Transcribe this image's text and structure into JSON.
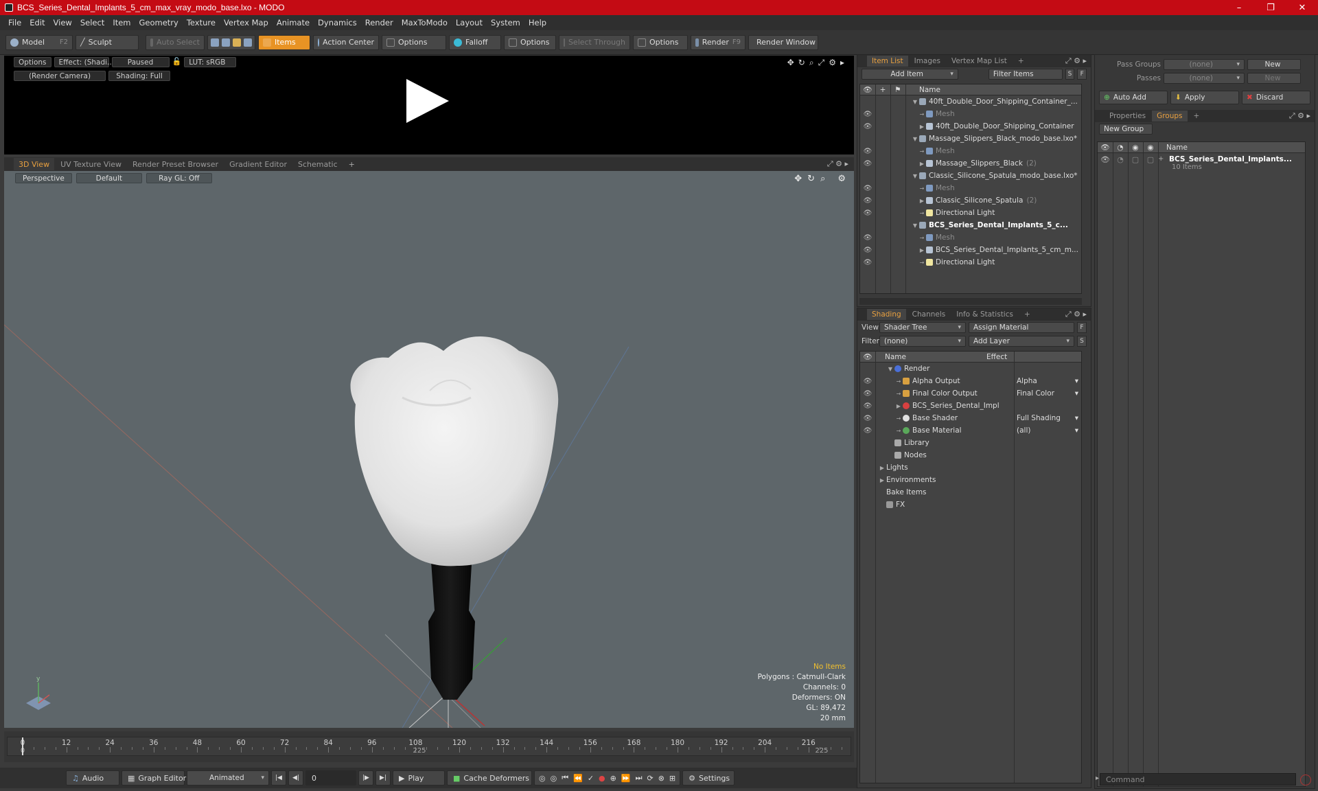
{
  "window": {
    "title": "BCS_Series_Dental_Implants_5_cm_max_vray_modo_base.lxo - MODO",
    "controls": [
      "–",
      "❐",
      "✕"
    ]
  },
  "menu": [
    "File",
    "Edit",
    "View",
    "Select",
    "Item",
    "Geometry",
    "Texture",
    "Vertex Map",
    "Animate",
    "Dynamics",
    "Render",
    "MaxToModo",
    "Layout",
    "System",
    "Help"
  ],
  "toolbar": {
    "model": "Model",
    "model_key": "F2",
    "sculpt": "Sculpt",
    "auto_select": "Auto Select",
    "items": "Items",
    "action_center": "Action Center",
    "options1": "Options",
    "falloff": "Falloff",
    "options2": "Options",
    "select_through": "Select Through",
    "options3": "Options",
    "render": "Render",
    "render_key": "F9",
    "render_window": "Render Window"
  },
  "preview": {
    "options": "Options",
    "effect": "Effect: (Shadi...",
    "paused": "Paused",
    "lut": "LUT: sRGB",
    "camera": "(Render Camera)",
    "shading": "Shading: Full"
  },
  "viewport_tabs": [
    "3D View",
    "UV Texture View",
    "Render Preset Browser",
    "Gradient Editor",
    "Schematic",
    "+"
  ],
  "viewport": {
    "projection": "Perspective",
    "style": "Default",
    "raygl": "Ray GL: Off",
    "info": {
      "no_items": "No Items",
      "polygons": "Polygons : Catmull-Clark",
      "channels": "Channels: 0",
      "deformers": "Deformers: ON",
      "gl": "GL: 89,472",
      "scale": "20 mm"
    }
  },
  "timeline": {
    "labels": [
      "0",
      "12",
      "24",
      "36",
      "48",
      "60",
      "72",
      "84",
      "96",
      "108",
      "120",
      "132",
      "144",
      "156",
      "168",
      "180",
      "192",
      "204",
      "216"
    ],
    "bottom_labels": [
      "0",
      "225",
      "225"
    ]
  },
  "bottombar": {
    "audio": "Audio",
    "graph_editor": "Graph Editor",
    "animated": "Animated",
    "frame": "0",
    "play": "Play",
    "cache_deformers": "Cache Deformers",
    "settings": "Settings"
  },
  "item_list": {
    "tabs": [
      "Item List",
      "Images",
      "Vertex Map List",
      "+"
    ],
    "add_item": "Add Item",
    "filter_items": "Filter Items",
    "s": "S",
    "f": "F",
    "col_name": "Name",
    "rows": [
      {
        "label": "40ft_Double_Door_Shipping_Container_...",
        "indent": 1,
        "arrow": "▼",
        "type": "scene"
      },
      {
        "label": "Mesh",
        "indent": 2,
        "arrow": "",
        "type": "mesh",
        "dim": true
      },
      {
        "label": "40ft_Double_Door_Shipping_Container",
        "indent": 2,
        "arrow": "▶",
        "type": "group"
      },
      {
        "label": "Massage_Slippers_Black_modo_base.lxo*",
        "indent": 1,
        "arrow": "▼",
        "type": "scene"
      },
      {
        "label": "Mesh",
        "indent": 2,
        "arrow": "",
        "type": "mesh",
        "dim": true
      },
      {
        "label": "Massage_Slippers_Black",
        "suffix": "(2)",
        "indent": 2,
        "arrow": "▶",
        "type": "group"
      },
      {
        "label": "Classic_Silicone_Spatula_modo_base.lxo*",
        "indent": 1,
        "arrow": "▼",
        "type": "scene"
      },
      {
        "label": "Mesh",
        "indent": 2,
        "arrow": "",
        "type": "mesh",
        "dim": true
      },
      {
        "label": "Classic_Silicone_Spatula",
        "suffix": "(2)",
        "indent": 2,
        "arrow": "▶",
        "type": "group"
      },
      {
        "label": "Directional Light",
        "indent": 2,
        "arrow": "",
        "type": "light"
      },
      {
        "label": "BCS_Series_Dental_Implants_5_c...",
        "indent": 1,
        "arrow": "▼",
        "type": "scene",
        "bold": true
      },
      {
        "label": "Mesh",
        "indent": 2,
        "arrow": "",
        "type": "mesh",
        "dim": true
      },
      {
        "label": "BCS_Series_Dental_Implants_5_cm_m...",
        "indent": 2,
        "arrow": "▶",
        "type": "group"
      },
      {
        "label": "Directional Light",
        "indent": 2,
        "arrow": "",
        "type": "light"
      }
    ]
  },
  "shading": {
    "tabs": [
      "Shading",
      "Channels",
      "Info & Statistics",
      "+"
    ],
    "view_label": "View",
    "view_value": "Shader Tree",
    "assign_material": "Assign Material",
    "filter_label": "Filter",
    "filter_value": "(none)",
    "add_layer": "Add Layer",
    "f": "F",
    "s": "S",
    "col_name": "Name",
    "col_effect": "Effect",
    "rows": [
      {
        "label": "Render",
        "effect": "",
        "indent": 1,
        "arrow": "▼",
        "icon": "render",
        "eye": false
      },
      {
        "label": "Alpha Output",
        "effect": "Alpha",
        "indent": 2,
        "arrow": "",
        "icon": "output",
        "eye": true
      },
      {
        "label": "Final Color Output",
        "effect": "Final Color",
        "indent": 2,
        "arrow": "",
        "icon": "output",
        "eye": true
      },
      {
        "label": "BCS_Series_Dental_Implan...",
        "effect": "",
        "indent": 2,
        "arrow": "▶",
        "icon": "material-group",
        "eye": true
      },
      {
        "label": "Base Shader",
        "effect": "Full Shading",
        "indent": 2,
        "arrow": "",
        "icon": "shader",
        "eye": true
      },
      {
        "label": "Base Material",
        "effect": "(all)",
        "indent": 2,
        "arrow": "",
        "icon": "material",
        "eye": true
      },
      {
        "label": "Library",
        "effect": "",
        "indent": 1,
        "arrow": "",
        "icon": "folder",
        "eye": false
      },
      {
        "label": "Nodes",
        "effect": "",
        "indent": 1,
        "arrow": "",
        "icon": "folder",
        "eye": false
      },
      {
        "label": "Lights",
        "effect": "",
        "indent": 0,
        "arrow": "▶",
        "icon": "",
        "eye": false
      },
      {
        "label": "Environments",
        "effect": "",
        "indent": 0,
        "arrow": "▶",
        "icon": "",
        "eye": false
      },
      {
        "label": "Bake Items",
        "effect": "",
        "indent": 0,
        "arrow": "",
        "icon": "",
        "eye": false
      },
      {
        "label": "FX",
        "effect": "",
        "indent": 0,
        "arrow": "",
        "icon": "fx",
        "eye": false
      }
    ]
  },
  "groups": {
    "pass_groups_label": "Pass Groups",
    "pass_groups_value": "(none)",
    "passes_label": "Passes",
    "passes_value": "(none)",
    "new1": "New",
    "new2": "New",
    "auto_add": "Auto Add",
    "apply": "Apply",
    "discard": "Discard",
    "tabs": [
      "Properties",
      "Groups",
      "+"
    ],
    "new_group": "New Group",
    "col_name": "Name",
    "item_name": "BCS_Series_Dental_Implants...",
    "item_count": "10 Items"
  },
  "command": {
    "placeholder": "Command"
  },
  "colors": {
    "titlebar": "#c40b14",
    "accent": "#e89324",
    "viewport_bg": "#5e666a"
  }
}
